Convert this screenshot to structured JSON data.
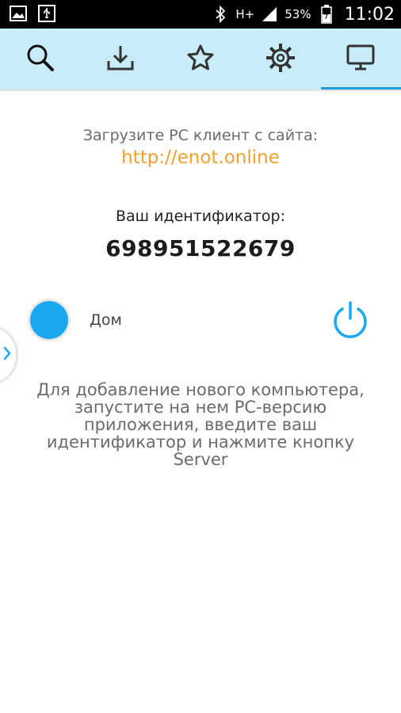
{
  "statusbar": {
    "icons_left": [
      "image-icon",
      "usb-icon"
    ],
    "network": "H+",
    "battery": "53%",
    "time": "11:02"
  },
  "tabs": [
    {
      "name": "search",
      "icon": "search-icon"
    },
    {
      "name": "download",
      "icon": "download-icon"
    },
    {
      "name": "favorites",
      "icon": "star-icon"
    },
    {
      "name": "settings",
      "icon": "gear-icon"
    },
    {
      "name": "computer",
      "icon": "monitor-icon",
      "active": true
    }
  ],
  "content": {
    "download_label": "Загрузите PC клиент с сайта:",
    "download_link": "http://enot.online",
    "id_label": "Ваш идентификатор:",
    "id_value": "698951522679",
    "device": {
      "name": "Дом",
      "status_color": "#1ba8ee"
    },
    "hint": "Для добавление нового компьютера, запустите на нем PC-версию приложения, введите ваш идентификатор и нажмите кнопку Server"
  },
  "colors": {
    "tabbar_bg": "#c9ecf9",
    "accent": "#1b9fdc",
    "link": "#f0a12e"
  }
}
